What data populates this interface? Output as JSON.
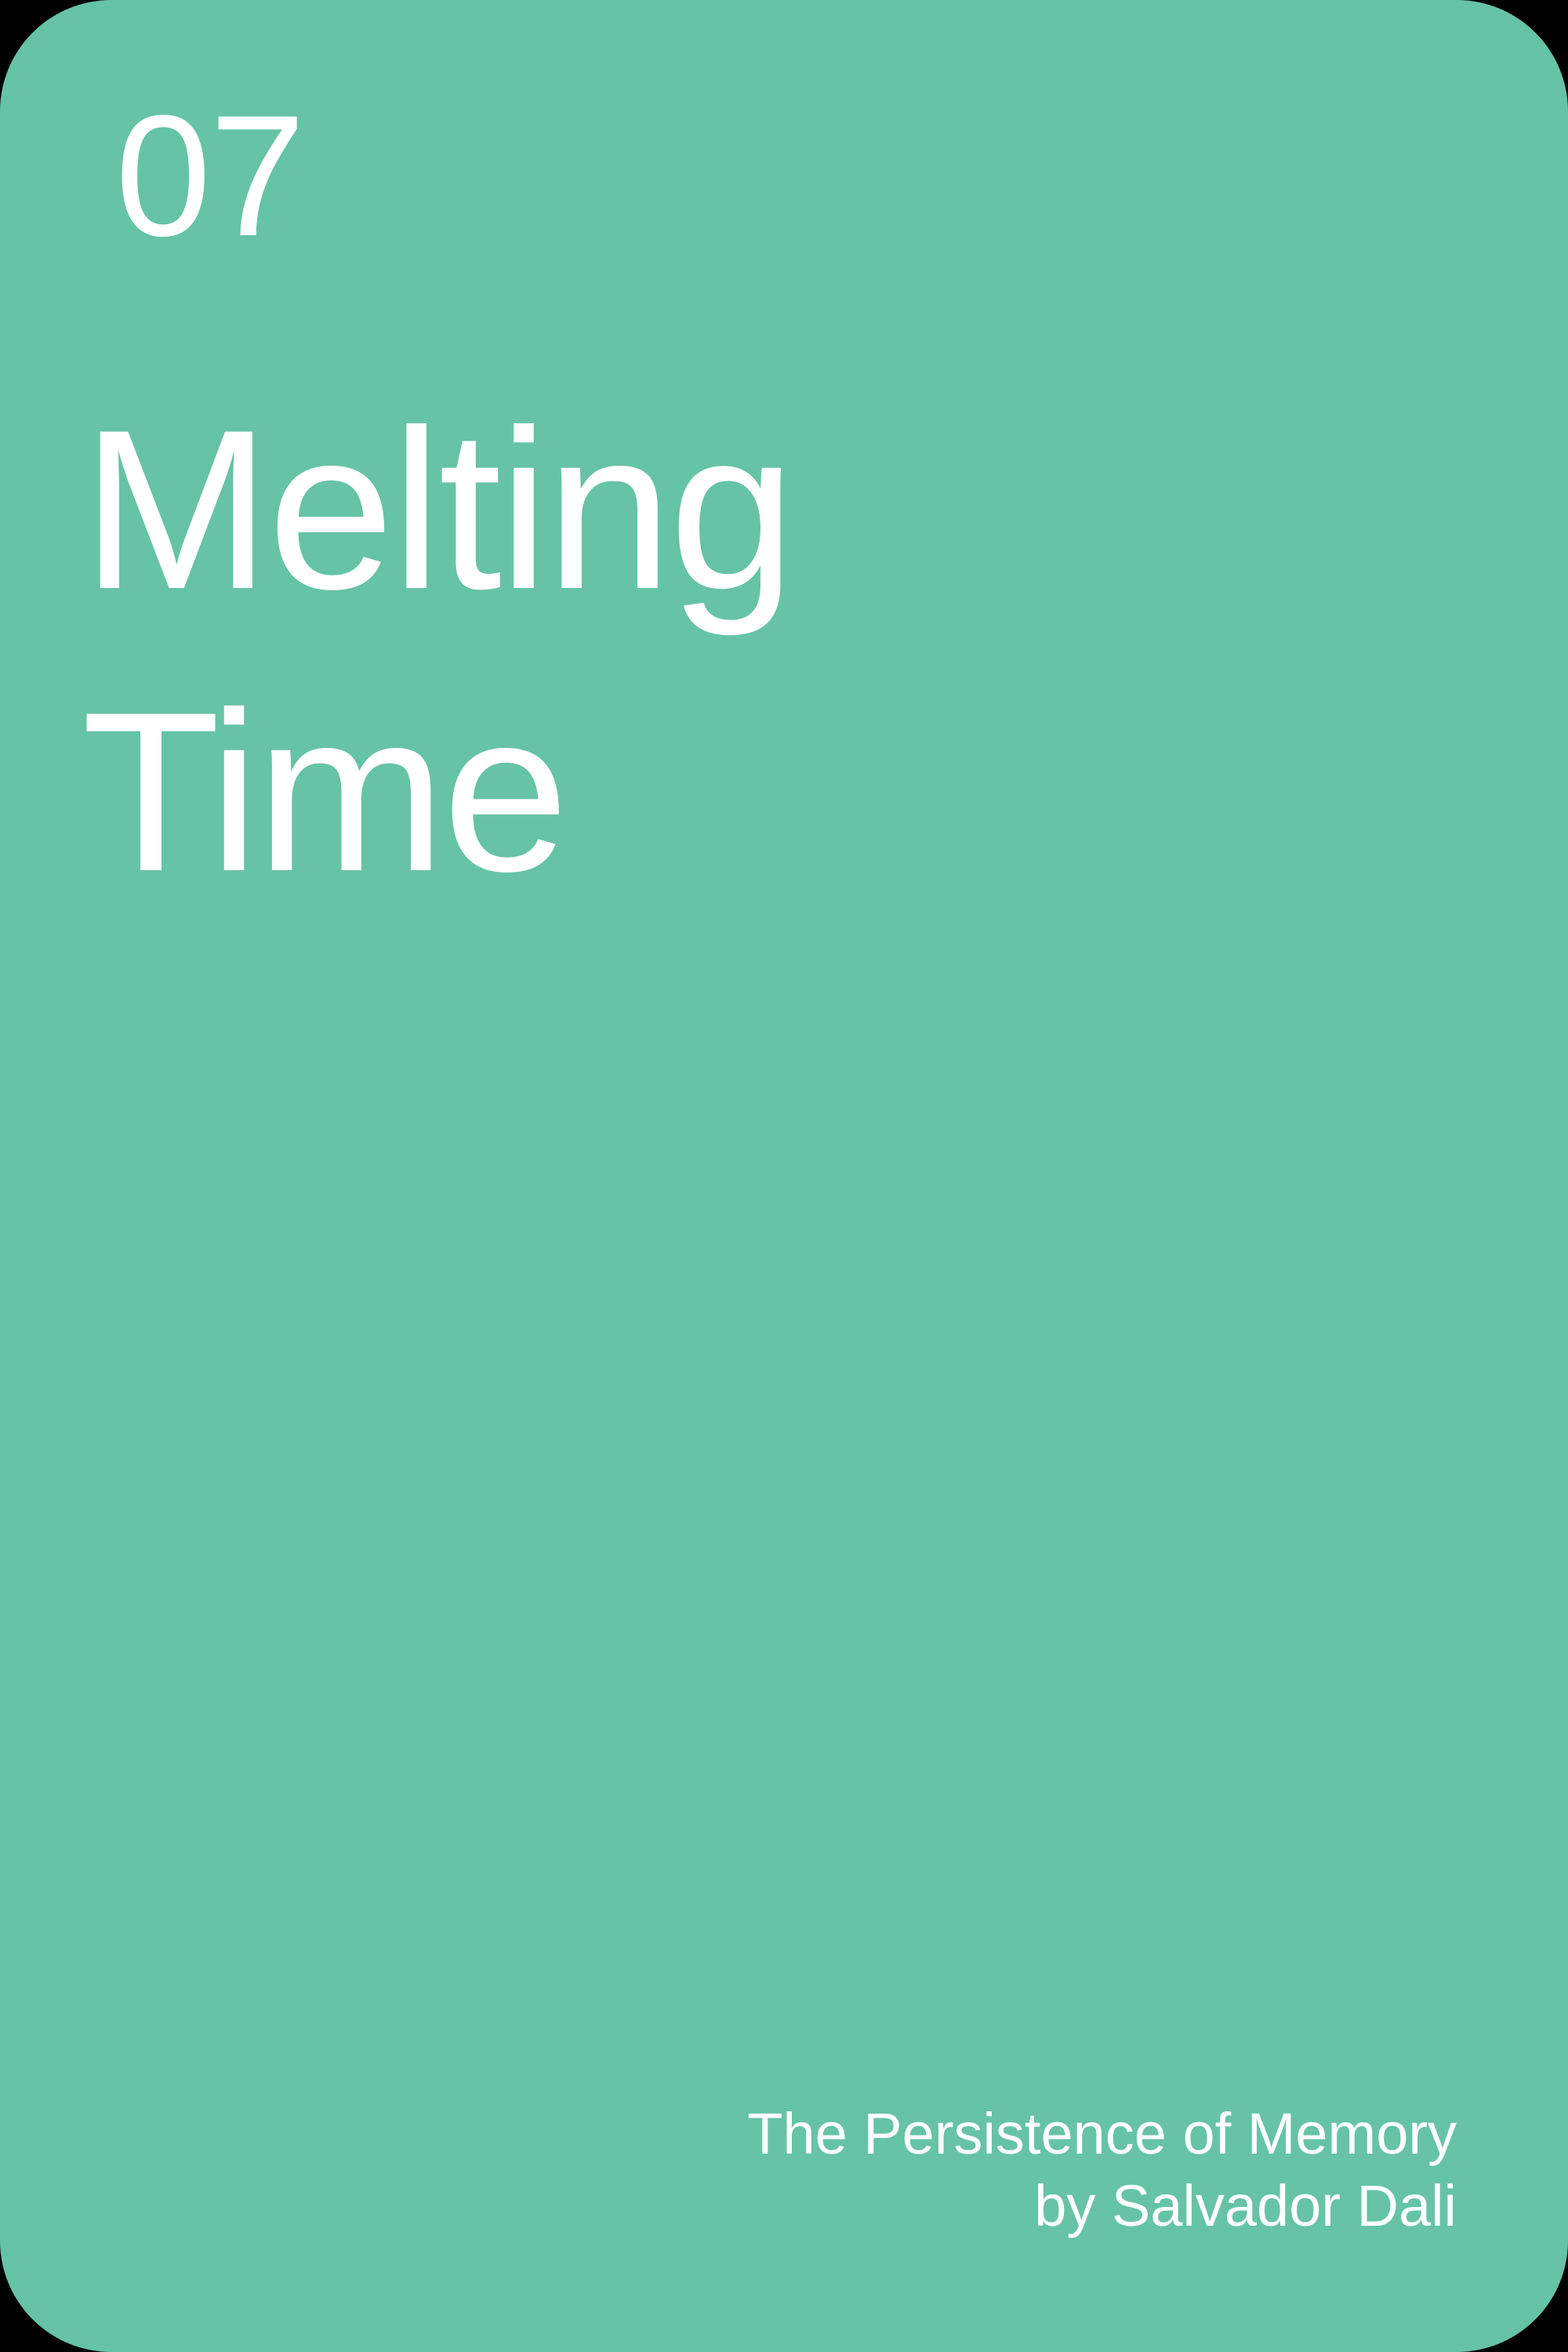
{
  "card": {
    "number": "07",
    "title_lines": [
      "Melting",
      "Time"
    ],
    "caption_lines": [
      "The Persistence of Memory",
      "by Salvador Dali"
    ],
    "background_color": "#66c3a6",
    "text_color": "#ffffff"
  }
}
